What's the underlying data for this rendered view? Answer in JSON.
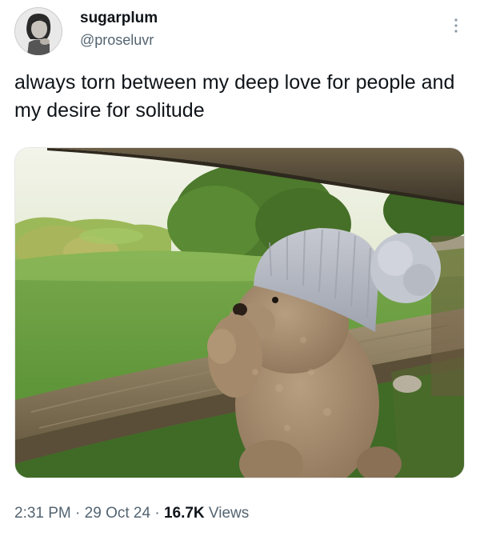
{
  "user": {
    "display_name": "sugarplum",
    "handle": "@proseluvr"
  },
  "tweet": {
    "text": "always torn between my deep love for people and my desire for solitude"
  },
  "meta": {
    "time": "2:31 PM",
    "separator_1": " · ",
    "date": "29 Oct 24",
    "separator_2": " · ",
    "views_count": "16.7K",
    "views_label": " Views"
  },
  "icons": {
    "more": "more-vertical-icon"
  },
  "colors": {
    "text_primary": "#0f1419",
    "text_secondary": "#536471",
    "grass": "#5f9a3c",
    "fence": "#8a7a5a",
    "beanie": "#b9bcc4"
  }
}
